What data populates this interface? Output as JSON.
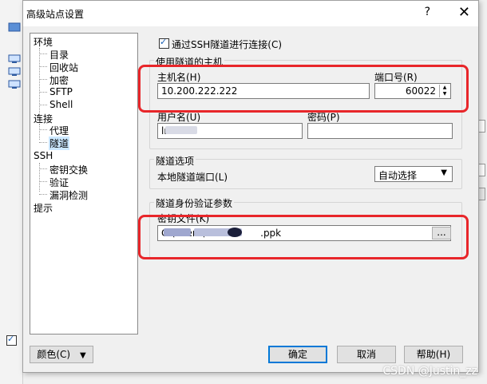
{
  "window": {
    "title": "高级站点设置",
    "help": "?",
    "close": "✕"
  },
  "tree": [
    {
      "label": "环境"
    },
    {
      "label": "目录"
    },
    {
      "label": "回收站"
    },
    {
      "label": "加密"
    },
    {
      "label": "SFTP"
    },
    {
      "label": "Shell"
    },
    {
      "label": "连接"
    },
    {
      "label": "代理"
    },
    {
      "label": "隧道",
      "selected": true
    },
    {
      "label": "SSH"
    },
    {
      "label": "密钥交换"
    },
    {
      "label": "验证"
    },
    {
      "label": "漏洞检测"
    },
    {
      "label": "提示"
    }
  ],
  "tunnel": {
    "checkbox_label": "通过SSH隧道进行连接(C)",
    "checked": true,
    "host_group": "使用隧道的主机",
    "host_label": "主机名(H)",
    "host_value": "10.200.222.222",
    "port_label": "端口号(R)",
    "port_value": "60022",
    "user_label": "用户名(U)",
    "user_value": "ln",
    "password_label": "密码(P)",
    "password_value": "",
    "options_group": "隧道选项",
    "local_port_label": "本地隧道端口(L)",
    "local_port_value": "自动选择",
    "auth_group": "隧道身份验证参数",
    "keyfile_label": "密钥文件(K)",
    "keyfile_prefix": "C:\\Users\\",
    "keyfile_suffix": ".ppk",
    "browse_label": "..."
  },
  "footer": {
    "color_label": "颜色(C)",
    "ok": "确定",
    "cancel": "取消",
    "help": "帮助(H)"
  },
  "watermark": "CSDN @Justin_zz"
}
